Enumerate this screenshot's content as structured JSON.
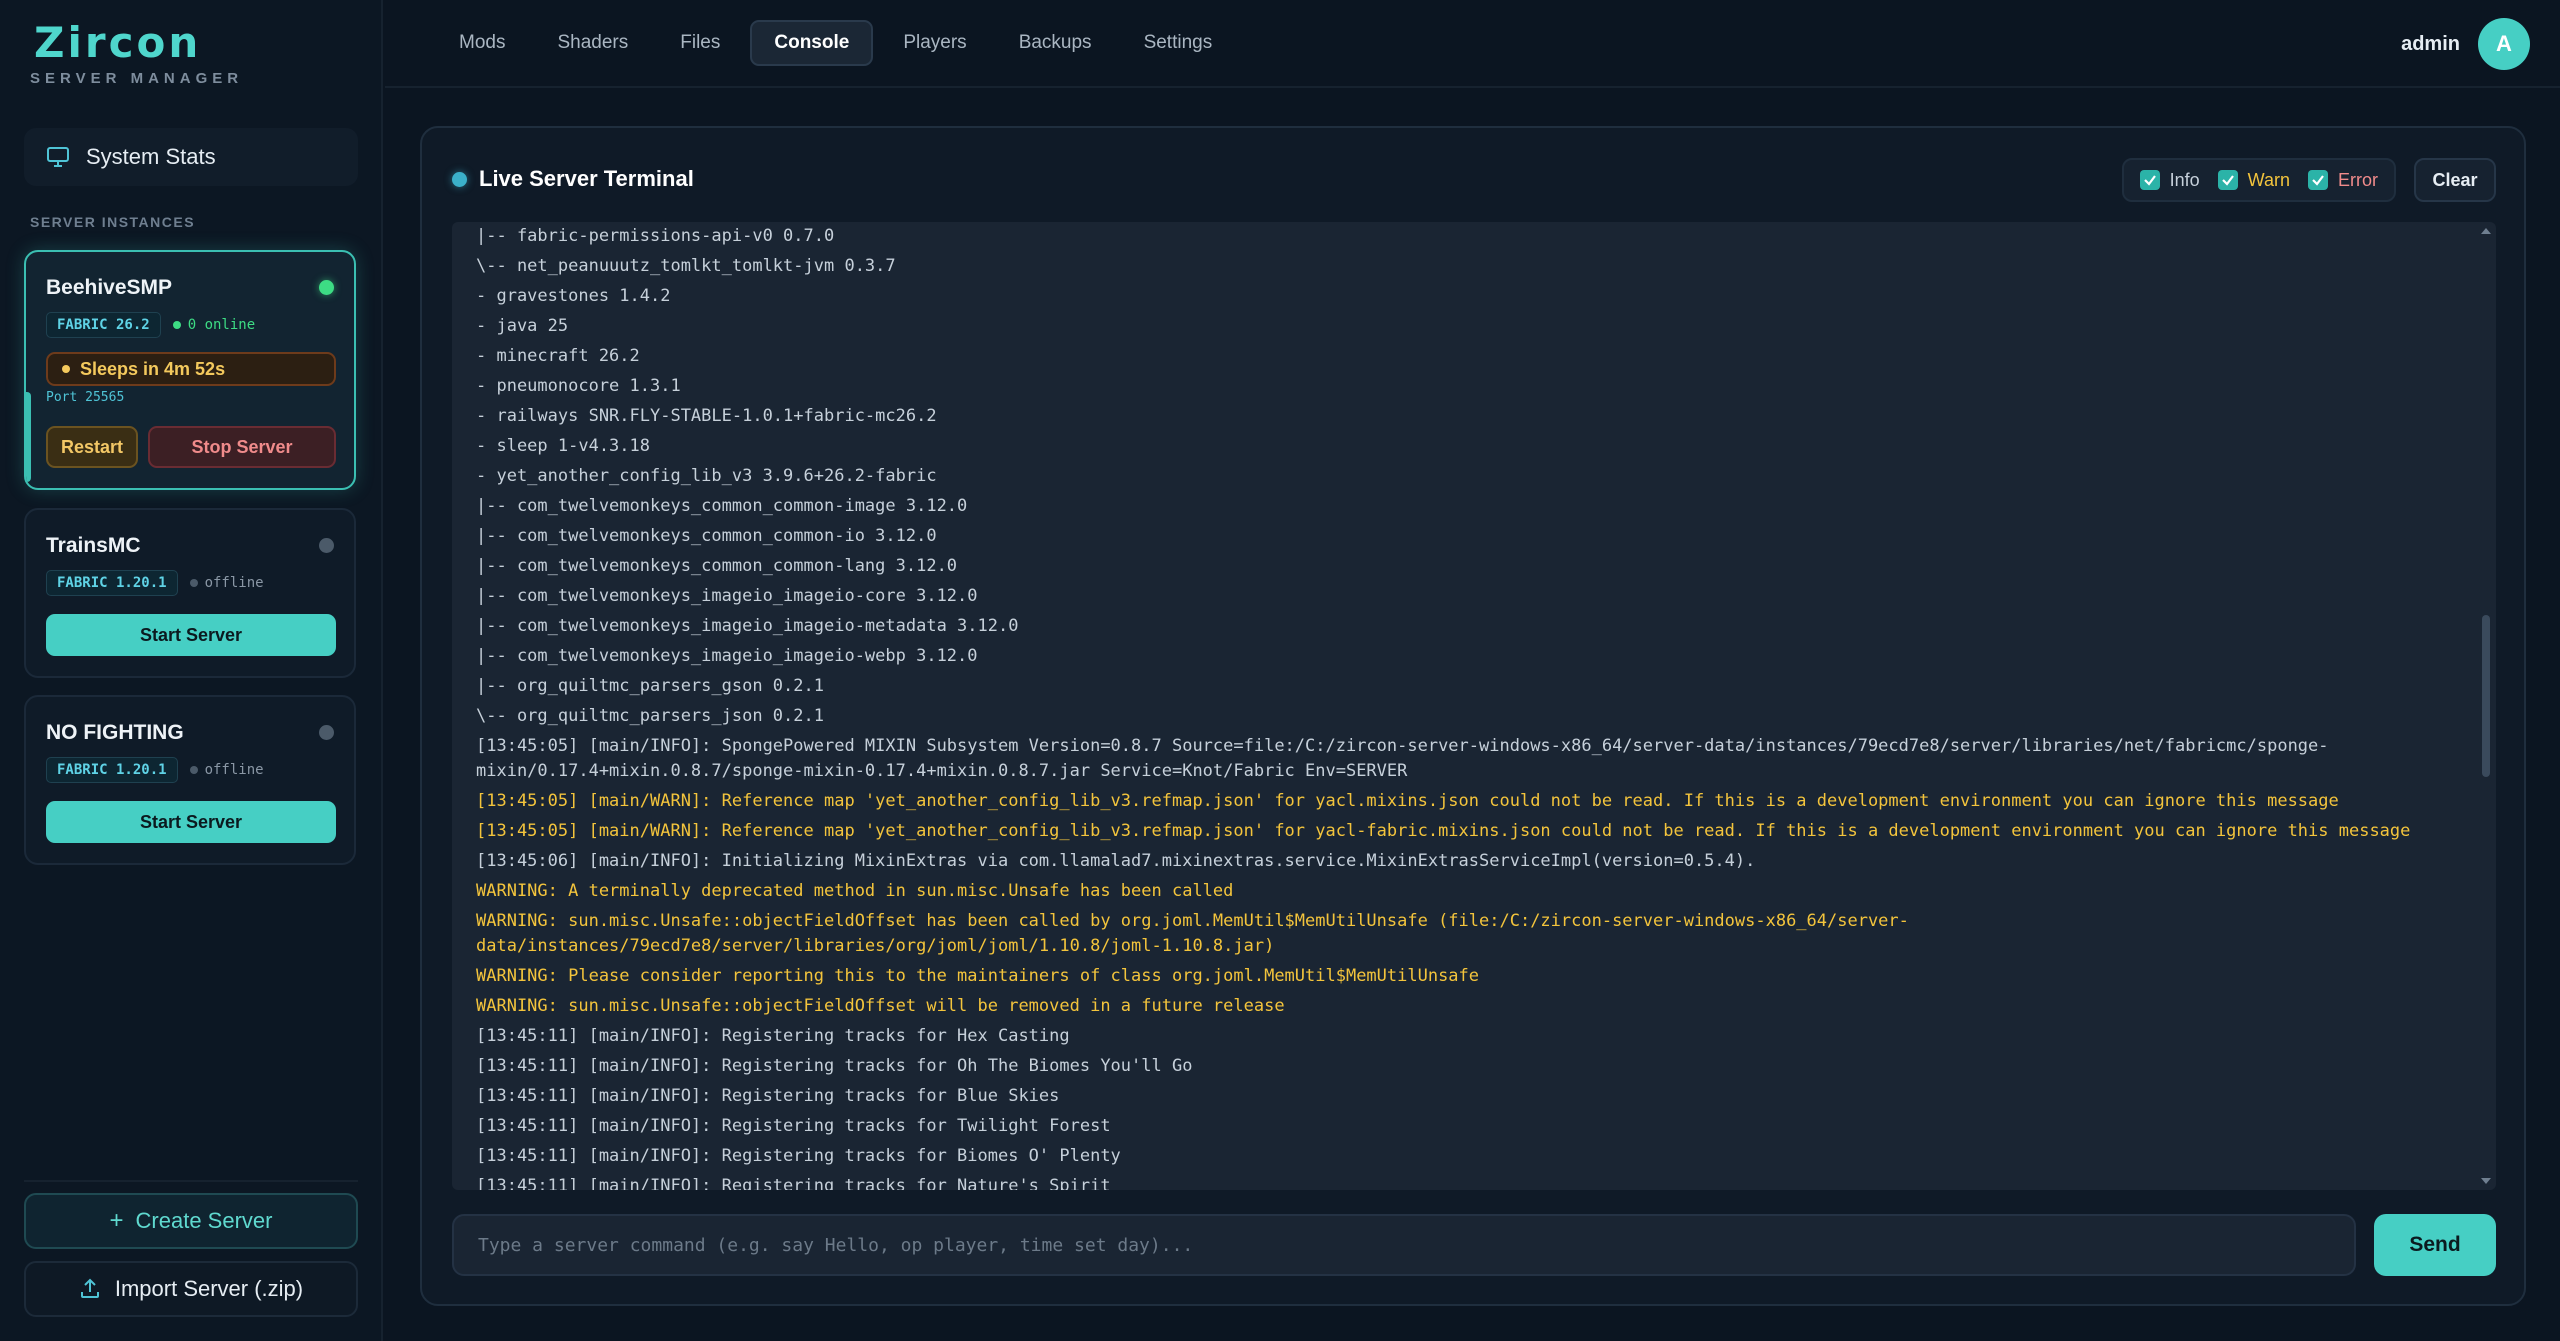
{
  "app": {
    "title": "Zircon",
    "subtitle": "SERVER MANAGER"
  },
  "sidebar": {
    "system_stats": "System Stats",
    "section_label": "SERVER INSTANCES",
    "servers": [
      {
        "name": "BeehiveSMP",
        "version": "FABRIC 26.2",
        "status_text": "0 online",
        "status": "online",
        "sleep": "Sleeps in 4m 52s",
        "port": "Port 25565",
        "restart": "Restart",
        "stop": "Stop Server"
      },
      {
        "name": "TrainsMC",
        "version": "FABRIC 1.20.1",
        "status_text": "offline",
        "status": "offline",
        "start": "Start Server"
      },
      {
        "name": "NO FIGHTING",
        "version": "FABRIC 1.20.1",
        "status_text": "offline",
        "status": "offline",
        "start": "Start Server"
      }
    ],
    "create_server": "Create Server",
    "import_server": "Import Server (.zip)"
  },
  "nav": {
    "tabs": [
      "Mods",
      "Shaders",
      "Files",
      "Console",
      "Players",
      "Backups",
      "Settings"
    ],
    "active_tab": "Console",
    "username": "admin",
    "avatar_initial": "A"
  },
  "terminal": {
    "title": "Live Server Terminal",
    "filters": {
      "info": "Info",
      "warn": "Warn",
      "error": "Error"
    },
    "clear": "Clear",
    "lines": [
      {
        "text": "|-- fabric-permissions-api-v0 0.7.0",
        "level": "info"
      },
      {
        "text": "\\-- net_peanuuutz_tomlkt_tomlkt-jvm 0.3.7",
        "level": "info"
      },
      {
        "text": "- gravestones 1.4.2",
        "level": "info"
      },
      {
        "text": "- java 25",
        "level": "info"
      },
      {
        "text": "- minecraft 26.2",
        "level": "info"
      },
      {
        "text": "- pneumonocore 1.3.1",
        "level": "info"
      },
      {
        "text": "- railways SNR.FLY-STABLE-1.0.1+fabric-mc26.2",
        "level": "info"
      },
      {
        "text": "- sleep 1-v4.3.18",
        "level": "info"
      },
      {
        "text": "- yet_another_config_lib_v3 3.9.6+26.2-fabric",
        "level": "info"
      },
      {
        "text": "|-- com_twelvemonkeys_common_common-image 3.12.0",
        "level": "info"
      },
      {
        "text": "|-- com_twelvemonkeys_common_common-io 3.12.0",
        "level": "info"
      },
      {
        "text": "|-- com_twelvemonkeys_common_common-lang 3.12.0",
        "level": "info"
      },
      {
        "text": "|-- com_twelvemonkeys_imageio_imageio-core 3.12.0",
        "level": "info"
      },
      {
        "text": "|-- com_twelvemonkeys_imageio_imageio-metadata 3.12.0",
        "level": "info"
      },
      {
        "text": "|-- com_twelvemonkeys_imageio_imageio-webp 3.12.0",
        "level": "info"
      },
      {
        "text": "|-- org_quiltmc_parsers_gson 0.2.1",
        "level": "info"
      },
      {
        "text": "\\-- org_quiltmc_parsers_json 0.2.1",
        "level": "info"
      },
      {
        "text": "[13:45:05] [main/INFO]: SpongePowered MIXIN Subsystem Version=0.8.7 Source=file:/C:/zircon-server-windows-x86_64/server-data/instances/79ecd7e8/server/libraries/net/fabricmc/sponge-\nmixin/0.17.4+mixin.0.8.7/sponge-mixin-0.17.4+mixin.0.8.7.jar Service=Knot/Fabric Env=SERVER",
        "level": "info",
        "wrap": true
      },
      {
        "text": "[13:45:05] [main/WARN]: Reference map 'yet_another_config_lib_v3.refmap.json' for yacl.mixins.json could not be read. If this is a development environment you can ignore this message",
        "level": "warn"
      },
      {
        "text": "[13:45:05] [main/WARN]: Reference map 'yet_another_config_lib_v3.refmap.json' for yacl-fabric.mixins.json could not be read. If this is a development environment you can ignore this message",
        "level": "warn"
      },
      {
        "text": "[13:45:06] [main/INFO]: Initializing MixinExtras via com.llamalad7.mixinextras.service.MixinExtrasServiceImpl(version=0.5.4).",
        "level": "info"
      },
      {
        "text": "WARNING: A terminally deprecated method in sun.misc.Unsafe has been called",
        "level": "warn"
      },
      {
        "text": "WARNING: sun.misc.Unsafe::objectFieldOffset has been called by org.joml.MemUtil$MemUtilUnsafe (file:/C:/zircon-server-windows-x86_64/server-\ndata/instances/79ecd7e8/server/libraries/org/joml/joml/1.10.8/joml-1.10.8.jar)",
        "level": "warn",
        "wrap": true
      },
      {
        "text": "WARNING: Please consider reporting this to the maintainers of class org.joml.MemUtil$MemUtilUnsafe",
        "level": "warn"
      },
      {
        "text": "WARNING: sun.misc.Unsafe::objectFieldOffset will be removed in a future release",
        "level": "warn"
      },
      {
        "text": "[13:45:11] [main/INFO]: Registering tracks for Hex Casting",
        "level": "info"
      },
      {
        "text": "[13:45:11] [main/INFO]: Registering tracks for Oh The Biomes You'll Go",
        "level": "info"
      },
      {
        "text": "[13:45:11] [main/INFO]: Registering tracks for Blue Skies",
        "level": "info"
      },
      {
        "text": "[13:45:11] [main/INFO]: Registering tracks for Twilight Forest",
        "level": "info"
      },
      {
        "text": "[13:45:11] [main/INFO]: Registering tracks for Biomes O' Plenty",
        "level": "info"
      },
      {
        "text": "[13:45:11] [main/INFO]: Registering tracks for Nature's Spirit",
        "level": "info"
      }
    ],
    "input_placeholder": "Type a server command (e.g. say Hello, op player, time set day)...",
    "send": "Send"
  },
  "colors": {
    "accent": "#46cfc4",
    "warn": "#f3c43c",
    "error": "#f08b8b",
    "online": "#3ddc84"
  }
}
